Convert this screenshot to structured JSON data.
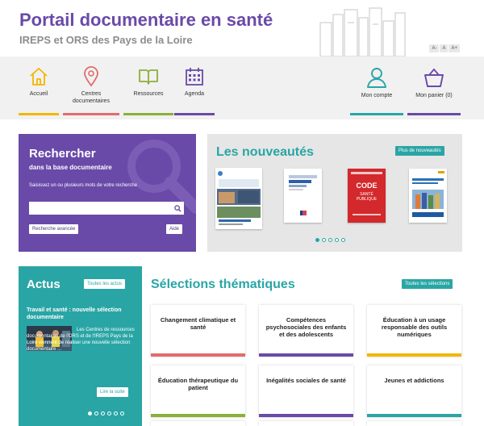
{
  "header": {
    "title": "Portail documentaire en santé",
    "subtitle": "IREPS et ORS des Pays de la Loire",
    "font_sizes": [
      "A-",
      "A",
      "A+"
    ]
  },
  "nav": {
    "items": [
      {
        "label": "Accueil",
        "icon": "home-icon",
        "color": "#f2b705"
      },
      {
        "label": "Centres documentaires",
        "icon": "map-pin-icon",
        "color": "#e06c6c"
      },
      {
        "label": "Ressources",
        "icon": "book-icon",
        "color": "#8bb03a"
      },
      {
        "label": "Agenda",
        "icon": "calendar-icon",
        "color": "#6a4aa8"
      },
      {
        "label": "Mon compte",
        "icon": "user-icon",
        "color": "#2aa5a5"
      },
      {
        "label": "Mon panier (0)",
        "icon": "basket-icon",
        "color": "#6a4aa8"
      }
    ]
  },
  "search": {
    "title": "Rechercher",
    "subtitle": "dans la base documentaire",
    "help": "Saisissez un ou plusieurs mots de votre recherche",
    "input_value": "",
    "advanced_label": "Recherche avancée",
    "help_label": "Aide"
  },
  "news": {
    "title": "Les nouveautés",
    "more_label": "Plus de nouveautés",
    "book3_text": "CODE SANTÉ PUBLIQUE",
    "slides": 5,
    "active_slide": 0
  },
  "actus": {
    "title": "Actus",
    "all_label": "Toutes les actus",
    "item_title": "Travail et santé : nouvelle sélection documentaire",
    "item_text": "Les Centres de ressources documentaires de l'ORS et de l'IREPS Pays de la Loire viennent de réaliser une nouvelle sélection documentaire ...",
    "read_more": "Lire la suite",
    "slides": 6,
    "active_slide": 0
  },
  "selections": {
    "title": "Sélections thématiques",
    "all_label": "Toutes les sélections",
    "cards": [
      {
        "label": "Changement climatique et santé",
        "color": "#e06c6c"
      },
      {
        "label": "Compétences psychosociales des enfants et des adolescents",
        "color": "#6a4aa8"
      },
      {
        "label": "Éducation à un usage responsable des outils numériques",
        "color": "#f2b705"
      },
      {
        "label": "Éducation thérapeutique du patient",
        "color": "#8bb03a"
      },
      {
        "label": "Inégalités sociales de santé",
        "color": "#6a4aa8"
      },
      {
        "label": "Jeunes et addictions",
        "color": "#2aa5a5"
      }
    ]
  },
  "colors": {
    "purple": "#6a4aa8",
    "teal": "#2aa5a5",
    "yellow": "#f2b705",
    "red": "#e06c6c",
    "green": "#8bb03a"
  }
}
